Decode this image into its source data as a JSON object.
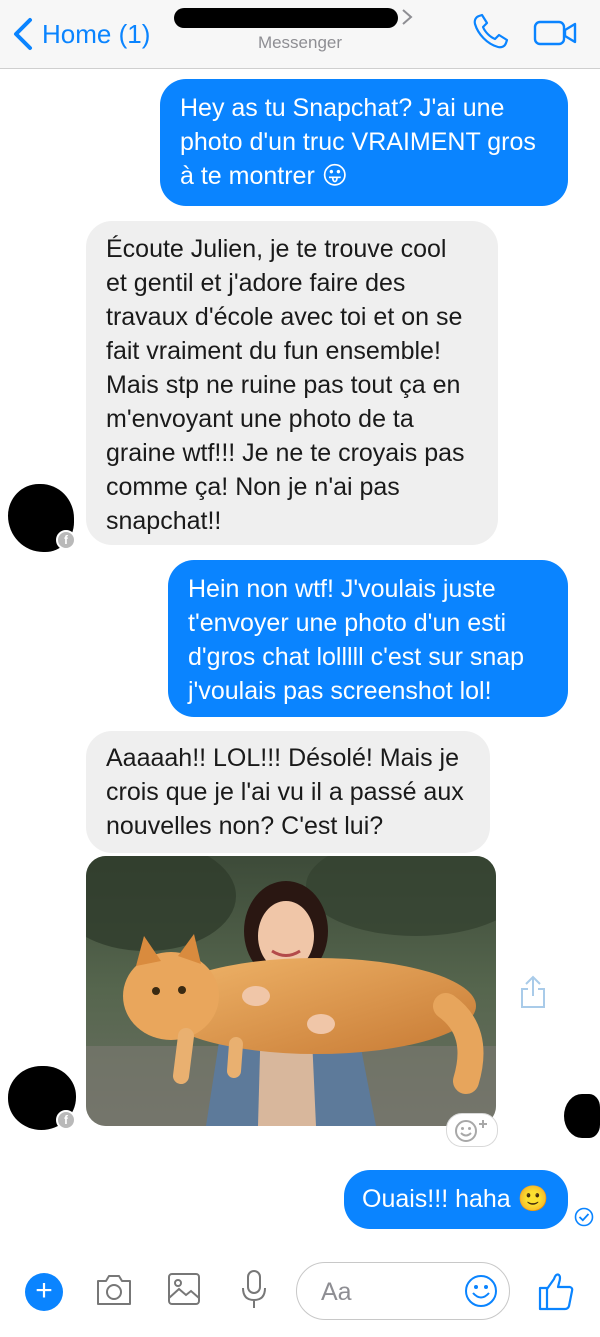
{
  "header": {
    "back_label": "Home (1)",
    "subtitle": "Messenger"
  },
  "messages": [
    {
      "direction": "outgoing",
      "text": "Hey as tu Snapchat? J'ai une\nphoto d'un truc VRAIMENT gros\nà te montrer 😛"
    },
    {
      "direction": "incoming",
      "text": "Écoute Julien, je te trouve cool\net gentil et j'adore faire des\ntravaux d'école avec toi et on se\nfait vraiment du fun ensemble!\nMais stp ne ruine pas tout ça en\nm'envoyant une photo de ta\ngraine wtf!!! Je ne te croyais pas\ncomme ça! Non je n'ai pas\nsnapchat!!"
    },
    {
      "direction": "outgoing",
      "text": "Hein non wtf! J'voulais juste\nt'envoyer une photo d'un esti\nd'gros chat lolllll c'est sur snap\nj'voulais pas screenshot lol!"
    },
    {
      "direction": "incoming",
      "text": "Aaaaah!! LOL!!! Désolé! Mais je\ncrois que je l'ai vu il a passé aux\nnouvelles non? C'est lui?"
    },
    {
      "direction": "outgoing",
      "text": "Ouais!!! haha 🙂"
    }
  ],
  "composer": {
    "placeholder": "Aa"
  },
  "icons": {
    "back": "chevron-left-icon",
    "call": "phone-icon",
    "video": "video-camera-icon",
    "share": "share-icon",
    "reaction": "smiley-plus-icon",
    "seen": "check-circle-icon",
    "plus": "plus-icon",
    "camera": "camera-icon",
    "gallery": "image-icon",
    "mic": "microphone-icon",
    "emoji": "smiley-icon",
    "like": "thumbs-up-icon",
    "badge": "facebook-badge-icon"
  },
  "colors": {
    "accent": "#0a84ff",
    "incoming_bubble": "#efefef",
    "outgoing_bubble": "#0a84ff"
  }
}
